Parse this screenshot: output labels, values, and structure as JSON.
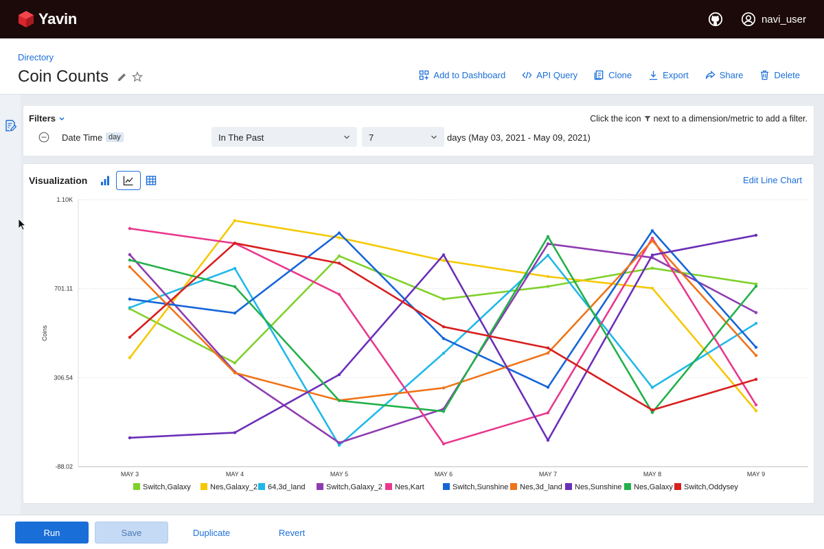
{
  "app": {
    "name": "Yavin",
    "user": "navi_user"
  },
  "header": {
    "breadcrumb": "Directory",
    "title": "Coin Counts",
    "actions": [
      {
        "label": "Add to Dashboard",
        "icon": "dashboard-icon"
      },
      {
        "label": "API Query",
        "icon": "code-icon"
      },
      {
        "label": "Clone",
        "icon": "clone-icon"
      },
      {
        "label": "Export",
        "icon": "download-icon"
      },
      {
        "label": "Share",
        "icon": "share-icon"
      },
      {
        "label": "Delete",
        "icon": "trash-icon"
      }
    ]
  },
  "filters": {
    "title": "Filters",
    "hint_prefix": "Click the icon",
    "hint_suffix": "next to a dimension/metric to add a filter.",
    "field": "Date Time",
    "grain": "day",
    "operator": "In The Past",
    "value": "7",
    "description": "days (May 03, 2021 - May 09, 2021)"
  },
  "visualization": {
    "title": "Visualization",
    "edit_label": "Edit Line Chart",
    "active_type": "line-chart"
  },
  "chart_data": {
    "type": "line",
    "x": [
      "MAY 3",
      "MAY 4",
      "MAY 5",
      "MAY 6",
      "MAY 7",
      "MAY 8",
      "MAY 9"
    ],
    "ylabel": "Coins",
    "y_ticks": [
      "1.10K",
      "701.11",
      "306.54",
      "-88.02"
    ],
    "ylim": [
      -88.02,
      1095.68
    ],
    "grid": true,
    "legend_position": "bottom",
    "series": [
      {
        "name": "Switch,Galaxy",
        "color": "#7fd12a",
        "values": [
          612,
          372,
          846,
          655,
          711,
          792,
          722
        ]
      },
      {
        "name": "Nes,Galaxy_2",
        "color": "#f5c800",
        "values": [
          395,
          1003,
          927,
          826,
          755,
          703,
          160
        ]
      },
      {
        "name": "64,3d_land",
        "color": "#20b8e8",
        "values": [
          617,
          791,
          7,
          415,
          849,
          263,
          547
        ]
      },
      {
        "name": "Switch,Galaxy_2",
        "color": "#8e3bb0",
        "values": [
          852,
          332,
          18,
          168,
          900,
          839,
          595
        ]
      },
      {
        "name": "Nes,Kart",
        "color": "#e8388c",
        "values": [
          968,
          902,
          676,
          13,
          151,
          925,
          186
        ]
      },
      {
        "name": "Switch,Sunshine",
        "color": "#1565d8",
        "values": [
          655,
          593,
          948,
          480,
          264,
          958,
          441
        ]
      },
      {
        "name": "Nes,3d_land",
        "color": "#ef7318",
        "values": [
          798,
          328,
          206,
          261,
          416,
          914,
          405
        ]
      },
      {
        "name": "Nes,Sunshine",
        "color": "#6a2fb8",
        "values": [
          40,
          63,
          320,
          851,
          29,
          850,
          938
        ]
      },
      {
        "name": "Nes,Galaxy",
        "color": "#22b04a",
        "values": [
          828,
          710,
          205,
          157,
          932,
          152,
          712
        ]
      },
      {
        "name": "Switch,Oddysey",
        "color": "#d81e1e",
        "values": [
          486,
          903,
          814,
          532,
          438,
          163,
          299
        ]
      }
    ]
  },
  "bottom_bar": {
    "run": "Run",
    "save": "Save",
    "duplicate": "Duplicate",
    "revert": "Revert"
  }
}
